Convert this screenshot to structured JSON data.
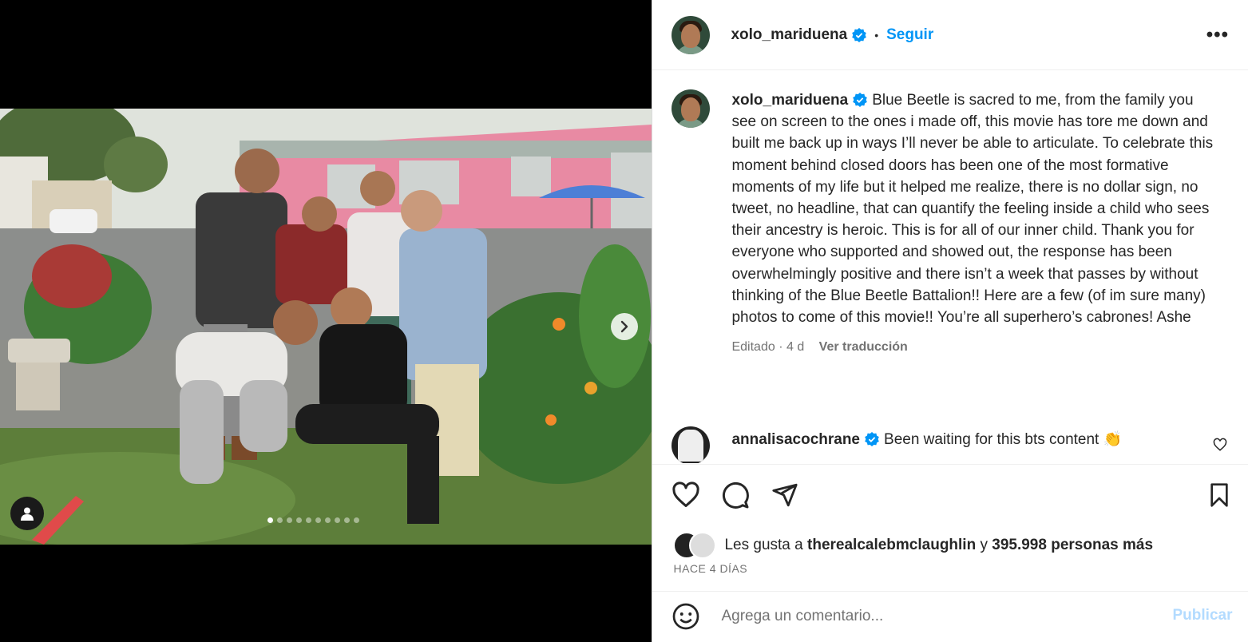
{
  "post": {
    "username": "xolo_mariduena",
    "follow_label": "Seguir",
    "separator": "•",
    "more_label": "•••",
    "caption_text": "Blue Beetle is sacred to me, from the family you see on screen to the ones i made off, this movie has tore me down and built me back up in ways I’ll never be able to articulate. To celebrate this moment behind closed doors has been one of the most formative moments of my life but it helped me realize, there is no dollar sign, no tweet, no headline, that can quantify the feeling inside a child who sees their ancestry is heroic. This is for all of our inner child. Thank you for everyone who supported and showed out, the response has been overwhelmingly positive and there isn’t a week that passes by without thinking of the Blue Beetle Battalion!! Here are a few (of im sure many) photos to come of this movie!! You’re all superhero’s cabrones! Ashe",
    "edited_label": "Editado · 4 d",
    "translate_label": "Ver traducción"
  },
  "comment": {
    "username": "annalisacochrane",
    "text": "Been waiting for this bts content 👏"
  },
  "likes": {
    "prefix": "Les gusta a",
    "user": "therealcalebmclaughlin",
    "connector": "y",
    "count": "395.998 personas más"
  },
  "date_label": "HACE 4 DÍAS",
  "add_comment": {
    "placeholder": "Agrega un comentario...",
    "post_label": "Publicar"
  },
  "carousel": {
    "total": 10,
    "active": 1
  },
  "colors": {
    "accent": "#0095f6",
    "verified": "#0095f6",
    "publish_disabled": "#b3dbff"
  },
  "icons": [
    "more-options-icon",
    "verified-badge-icon",
    "heart-icon",
    "comment-icon",
    "share-icon",
    "bookmark-icon",
    "chevron-right-icon",
    "user-tag-icon",
    "emoji-icon"
  ]
}
